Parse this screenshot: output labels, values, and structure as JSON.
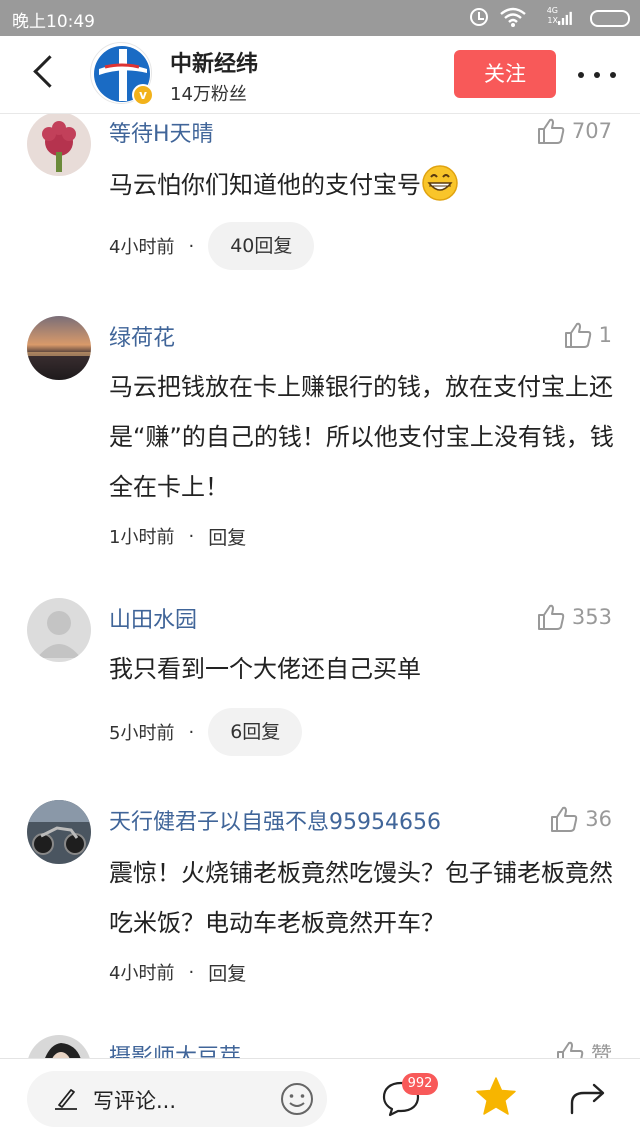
{
  "status_bar": {
    "time": "晚上10:49",
    "network": "4G",
    "network_sub": "1X"
  },
  "header": {
    "publisher_name": "中新经纬",
    "fans": "14万粉丝",
    "follow_label": "关注"
  },
  "comments": [
    {
      "username": "等待H天晴",
      "likes": "707",
      "text": "马云怕你们知道他的支付宝号",
      "emoji": "grinning-face",
      "time": "4小时前",
      "reply": "40回复"
    },
    {
      "username": "绿荷花",
      "likes": "1",
      "text": "马云把钱放在卡上赚银行的钱，放在支付宝上还是“赚”的自己的钱！所以他支付宝上没有钱，钱全在卡上！",
      "time": "1小时前",
      "reply": "回复"
    },
    {
      "username": "山田水园",
      "likes": "353",
      "text": "我只看到一个大佬还自己买单",
      "time": "5小时前",
      "reply": "6回复"
    },
    {
      "username": "天行健君子以自强不息95954656",
      "likes": "36",
      "text": "震惊！火烧铺老板竟然吃馒头？包子铺老板竟然吃米饭？电动车老板竟然开车？",
      "time": "4小时前",
      "reply": "回复"
    },
    {
      "username": "摄影师大豆芽",
      "likes": "赞"
    }
  ],
  "meta_separator": "·",
  "bottom_bar": {
    "comment_placeholder": "写评论...",
    "comment_count_badge": "992"
  },
  "colors": {
    "username": "#406599",
    "follow_button": "#f85959",
    "badge": "#f85959",
    "star": "#f7b500",
    "status_bar": "#9a9a9a"
  }
}
